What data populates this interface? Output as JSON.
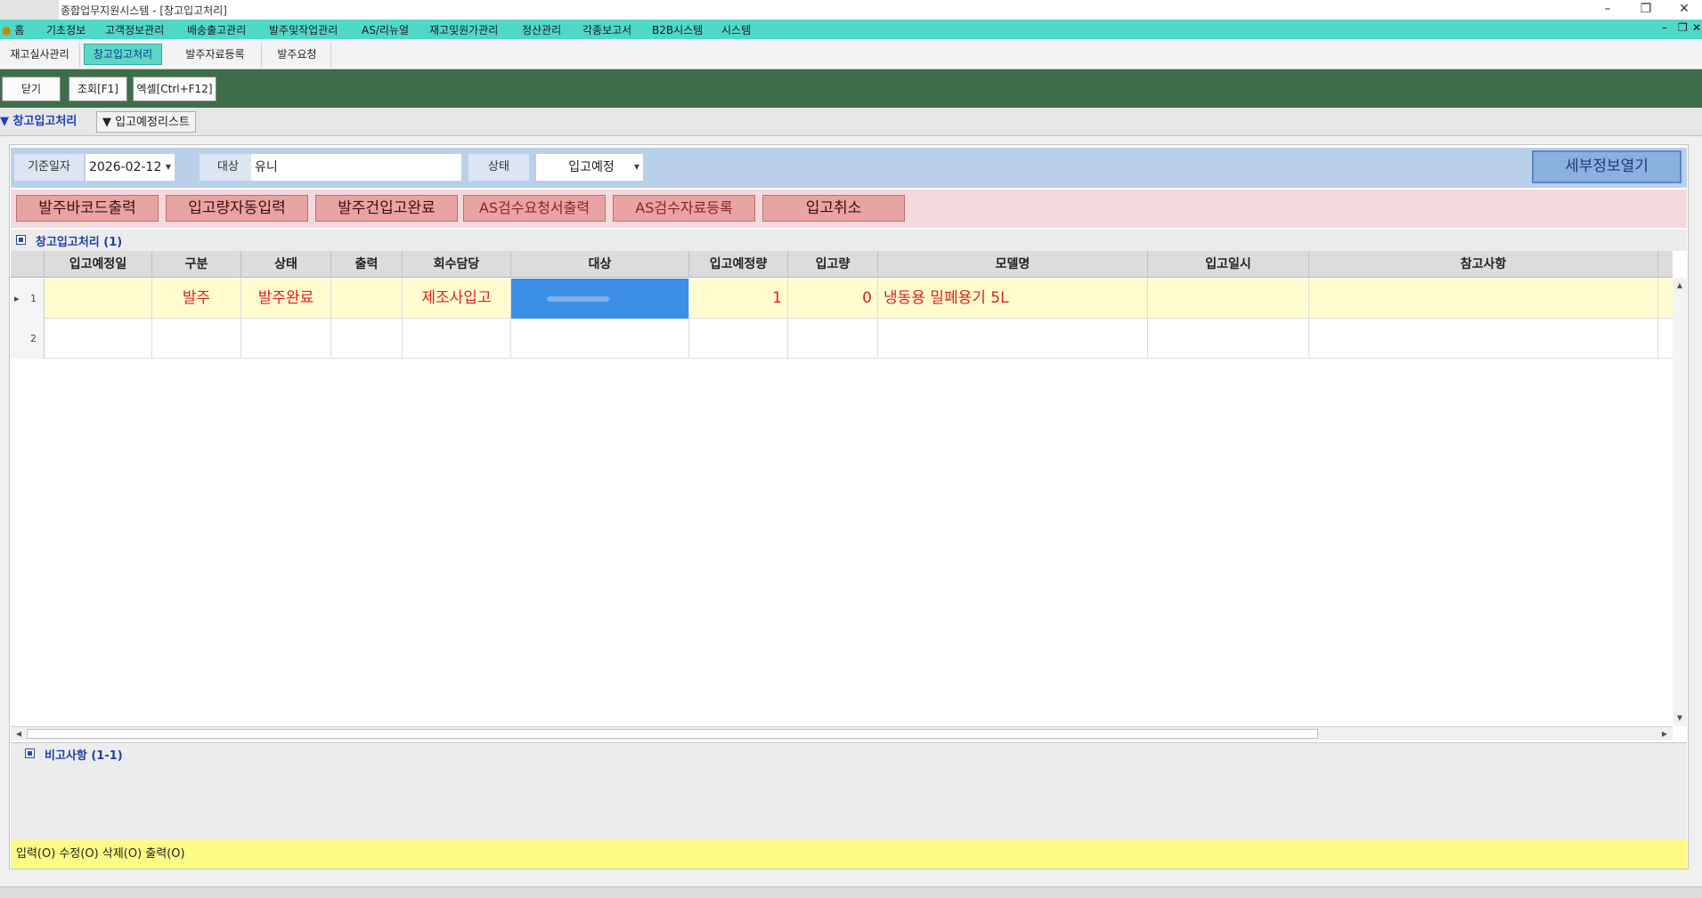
{
  "window": {
    "title": "종합업무지원시스템 - [창고입고처리]",
    "minimize": "–",
    "restore": "❐",
    "close": "✕"
  },
  "menu": {
    "items": [
      "홈",
      "기초정보",
      "고객정보관리",
      "배송출고관리",
      "발주및작업관리",
      "AS/리뉴얼",
      "재고및원가관리",
      "정산관리",
      "각종보고서",
      "B2B시스템",
      "시스템"
    ],
    "mdi_minimize": "–",
    "mdi_restore": "❐",
    "mdi_close": "✕"
  },
  "tabs": [
    "재고실사관리",
    "창고입고처리",
    "발주자료등록",
    "발주요청"
  ],
  "toolbar": {
    "close_label": "닫기",
    "search_label": "조회[F1]",
    "excel_label": "엑셀[Ctrl+F12]"
  },
  "subtabs": {
    "active": "▼ 창고입고처리",
    "other": "▼ 입고예정리스트"
  },
  "filter": {
    "date_label": "기준일자",
    "date_value": "2026-02-12",
    "target_label": "대상",
    "target_value": "유니",
    "status_label": "상태",
    "status_value": "입고예정",
    "detail_button": "세부정보열기"
  },
  "actions": {
    "barcode": "발주바코드출력",
    "auto_input": "입고량자동입력",
    "complete": "발주건입고완료",
    "as_request": "AS검수요청서출력",
    "as_register": "AS검수자료등록",
    "cancel": "입고취소"
  },
  "grid": {
    "caption": "창고입고처리 (1)",
    "columns": [
      "입고예정일",
      "구분",
      "상태",
      "출력",
      "회수담당",
      "대상",
      "입고예정량",
      "입고량",
      "모델명",
      "입고일시",
      "참고사항"
    ],
    "rows": [
      {
        "num": "1",
        "marker": "▸",
        "date": "",
        "type": "발주",
        "status": "발주완료",
        "print": "",
        "collector": "제조사입고",
        "target": "",
        "planned_qty": "1",
        "received_qty": "0",
        "model": "냉동용 밀폐용기 5L",
        "received_at": "",
        "note": ""
      },
      {
        "num": "2",
        "marker": "",
        "date": "",
        "type": "",
        "status": "",
        "print": "",
        "collector": "",
        "target": "",
        "planned_qty": "",
        "received_qty": "",
        "model": "",
        "received_at": "",
        "note": ""
      }
    ]
  },
  "memo": {
    "caption": "비고사항 (1-1)"
  },
  "status_bar": "입력(O) 수정(O) 삭제(O) 출력(O)",
  "colors": {
    "menu_bg": "#4fd8c8",
    "toolbar_bg": "#3d6e4a",
    "filter_bg": "#b9d0ea",
    "action_bg": "#f4d9dc",
    "selected_row": "#fffdd0",
    "row_text": "#e02020",
    "status_bg": "#fcfc84"
  }
}
